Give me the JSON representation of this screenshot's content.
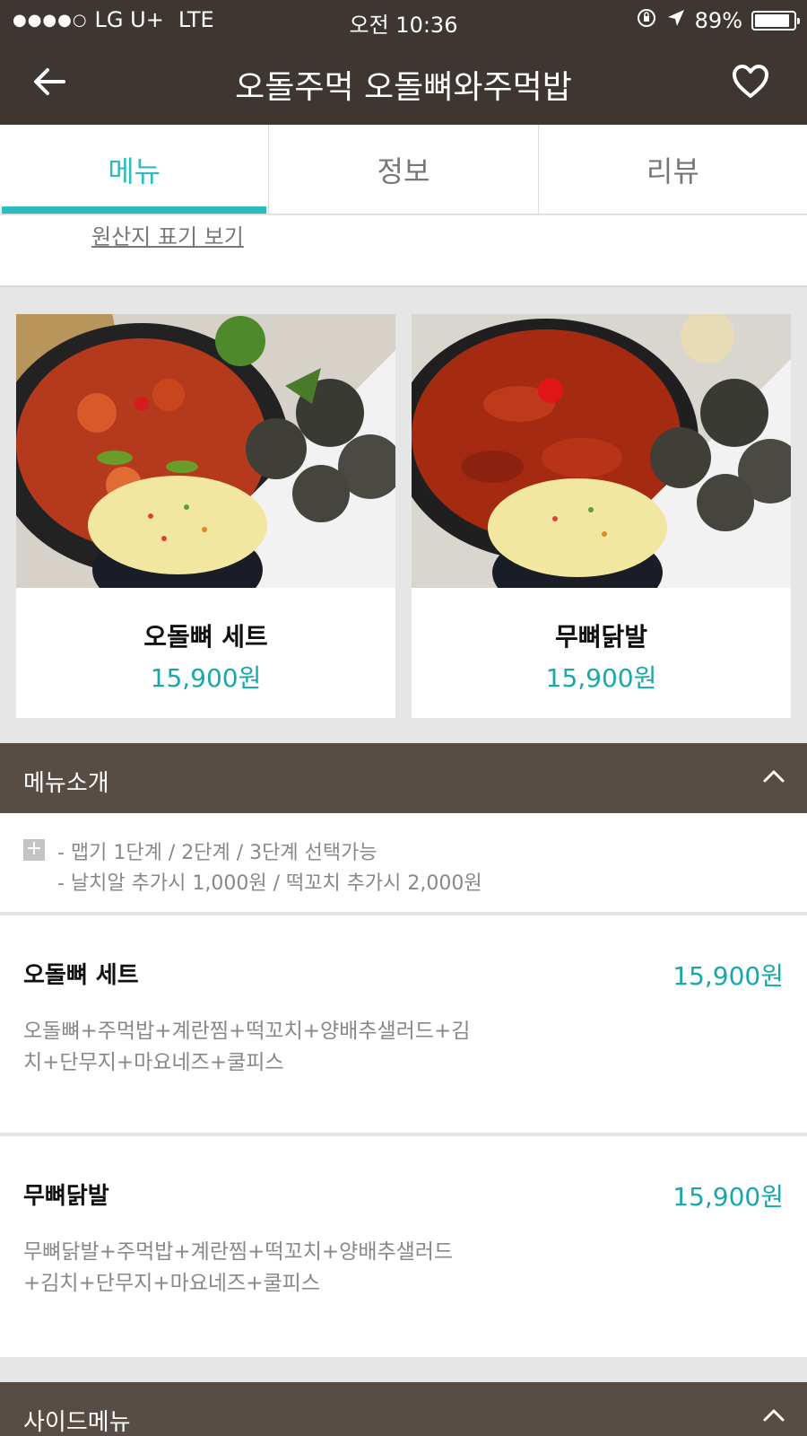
{
  "status_bar": {
    "signal": "●●●●○",
    "carrier": "LG U+",
    "network": "LTE",
    "time": "오전 10:36",
    "battery": "89%"
  },
  "header": {
    "title": "오돌주먹 오돌뼈와주먹밥"
  },
  "tabs": [
    {
      "label": "메뉴",
      "active": true
    },
    {
      "label": "정보",
      "active": false
    },
    {
      "label": "리뷰",
      "active": false
    }
  ],
  "origin_link": "원산지 표기 보기",
  "cards": [
    {
      "name": "오돌뼈 세트",
      "price": "15,900원"
    },
    {
      "name": "무뼈닭발",
      "price": "15,900원"
    }
  ],
  "menu_intro": {
    "title": "메뉴소개",
    "lines": [
      "- 맵기 1단계 / 2단계 / 3단계 선택가능",
      "- 날치알 추가시 1,000원 / 떡꼬치 추가시 2,000원"
    ]
  },
  "menu_items": [
    {
      "name": "오돌뼈 세트",
      "price": "15,900원",
      "desc_lines": [
        "오돌뼈+주먹밥+계란찜+떡꼬치+양배추샐러드+김",
        "치+단무지+마요네즈+쿨피스"
      ]
    },
    {
      "name": "무뼈닭발",
      "price": "15,900원",
      "desc_lines": [
        "무뼈닭발+주먹밥+계란찜+떡꼬치+양배추샐러드",
        "+김치+단무지+마요네즈+쿨피스"
      ]
    }
  ],
  "side_menu": {
    "title": "사이드메뉴"
  },
  "colors": {
    "header_bg": "#3e3630",
    "section_bg": "#574d45",
    "accent": "#2bbcc0",
    "price": "#17a8ac"
  },
  "icons": [
    "back-arrow-icon",
    "heart-icon",
    "rotation-lock-icon",
    "location-arrow-icon",
    "battery-icon",
    "chevron-up-icon",
    "plus-icon"
  ]
}
